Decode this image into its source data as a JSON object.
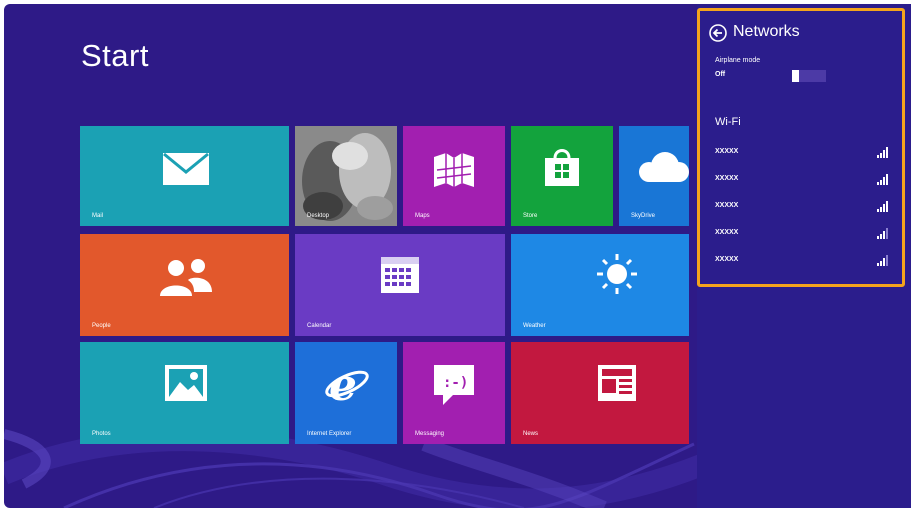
{
  "start": {
    "title": "Start"
  },
  "tiles": [
    {
      "key": "mail",
      "label": "Mail",
      "icon": "envelope-icon",
      "color": "#1ba1b4"
    },
    {
      "key": "desktop",
      "label": "Desktop",
      "icon": "desktop-photo",
      "color": "#6b6b6b"
    },
    {
      "key": "maps",
      "label": "Maps",
      "icon": "map-icon",
      "color": "#a21fb0"
    },
    {
      "key": "store",
      "label": "Store",
      "icon": "shopping-bag-icon",
      "color": "#13a33d"
    },
    {
      "key": "skydrive",
      "label": "SkyDrive",
      "icon": "cloud-icon",
      "color": "#1976d6"
    },
    {
      "key": "people",
      "label": "People",
      "icon": "people-icon",
      "color": "#e2582c"
    },
    {
      "key": "calendar",
      "label": "Calendar",
      "icon": "calendar-icon",
      "color": "#6a3bc4"
    },
    {
      "key": "weather",
      "label": "Weather",
      "icon": "sun-icon",
      "color": "#1e88e5"
    },
    {
      "key": "photos",
      "label": "Photos",
      "icon": "picture-icon",
      "color": "#1ba1b4"
    },
    {
      "key": "ie",
      "label": "Internet Explorer",
      "icon": "internet-explorer-icon",
      "color": "#1e6fd9"
    },
    {
      "key": "messaging",
      "label": "Messaging",
      "icon": "chat-bubble-icon",
      "color": "#a21fb0"
    },
    {
      "key": "news",
      "label": "News",
      "icon": "newspaper-icon",
      "color": "#c2183f"
    }
  ],
  "networks": {
    "title": "Networks",
    "back_icon": "back-arrow-icon",
    "airplane_mode": {
      "label": "Airplane mode",
      "state": "Off"
    },
    "wifi_heading": "Wi-Fi",
    "items": [
      {
        "name": "XXXXX",
        "signal_bars": 4
      },
      {
        "name": "XXXXX",
        "signal_bars": 4
      },
      {
        "name": "XXXXX",
        "signal_bars": 4
      },
      {
        "name": "XXXXX",
        "signal_bars": 3
      },
      {
        "name": "XXXXX",
        "signal_bars": 3
      }
    ]
  },
  "colors": {
    "background": "#2e1a87",
    "highlight": "#f4a41c"
  }
}
